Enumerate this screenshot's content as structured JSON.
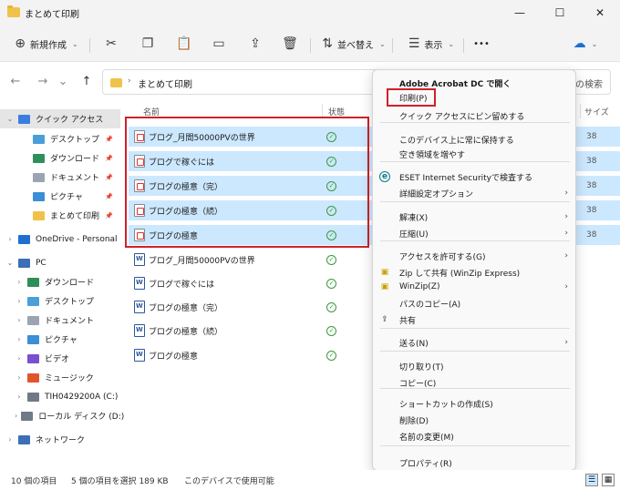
{
  "window": {
    "title": "まとめて印刷",
    "minimize": "—",
    "maximize": "☐",
    "close": "✕"
  },
  "toolbar": {
    "new_label": "新規作成",
    "sort_label": "並べ替え",
    "view_label": "表示",
    "more_label": "•••"
  },
  "address": {
    "path": "まとめて印刷",
    "search_placeholder": "の検索"
  },
  "sidebar": {
    "items": [
      {
        "label": "クイック アクセス",
        "color": "#3b7de0"
      },
      {
        "label": "デスクトップ",
        "color": "#4a9fd8",
        "pinned": true
      },
      {
        "label": "ダウンロード",
        "color": "#2f8f5a",
        "pinned": true
      },
      {
        "label": "ドキュメント",
        "color": "#9aa5b1",
        "pinned": true
      },
      {
        "label": "ピクチャ",
        "color": "#3a8fd6",
        "pinned": true
      },
      {
        "label": "まとめて印刷",
        "color": "#f0c24b",
        "pinned": true
      },
      {
        "label": "OneDrive - Personal",
        "color": "#1e6fd0"
      },
      {
        "label": "PC",
        "color": "#3b6fb6"
      },
      {
        "label": "ダウンロード",
        "color": "#2f8f5a"
      },
      {
        "label": "デスクトップ",
        "color": "#4a9fd8"
      },
      {
        "label": "ドキュメント",
        "color": "#9aa5b1"
      },
      {
        "label": "ピクチャ",
        "color": "#3a8fd6"
      },
      {
        "label": "ビデオ",
        "color": "#7a4fd0"
      },
      {
        "label": "ミュージック",
        "color": "#e0552a"
      },
      {
        "label": "TIH0429200A (C:)",
        "color": "#6f7a86"
      },
      {
        "label": "ローカル ディスク (D:)",
        "color": "#6f7a86"
      },
      {
        "label": "ネットワーク",
        "color": "#3b6fb6"
      }
    ]
  },
  "columns": {
    "name": "名前",
    "status": "状態",
    "size": "サイズ"
  },
  "files": [
    {
      "name": "ブログ_月間50000PVの世界",
      "type": "pdf",
      "selected": true,
      "size": "38"
    },
    {
      "name": "ブログで稼ぐには",
      "type": "pdf",
      "selected": true,
      "size": "38"
    },
    {
      "name": "ブログの極意（完）",
      "type": "pdf",
      "selected": true,
      "size": "38"
    },
    {
      "name": "ブログの極意（続）",
      "type": "pdf",
      "selected": true,
      "size": "38"
    },
    {
      "name": "ブログの極意",
      "type": "pdf",
      "selected": true,
      "size": "38"
    },
    {
      "name": "ブログ_月間50000PVの世界",
      "type": "doc",
      "selected": false,
      "size": ""
    },
    {
      "name": "ブログで稼ぐには",
      "type": "doc",
      "selected": false,
      "size": ""
    },
    {
      "name": "ブログの極意（完）",
      "type": "doc",
      "selected": false,
      "size": ""
    },
    {
      "name": "ブログの極意（続）",
      "type": "doc",
      "selected": false,
      "size": ""
    },
    {
      "name": "ブログの極意",
      "type": "doc",
      "selected": false,
      "size": ""
    }
  ],
  "context_menu": {
    "items": [
      {
        "label": "Adobe Acrobat DC で開く",
        "bold": true
      },
      {
        "label": "印刷(P)"
      },
      {
        "label": "クイック アクセスにピン留めする"
      },
      {
        "sep": true
      },
      {
        "label": "このデバイス上に常に保持する"
      },
      {
        "label": "空き領域を増やす"
      },
      {
        "sep": true
      },
      {
        "label": "ESET Internet Securityで検査する",
        "icon": "eset-icon"
      },
      {
        "label": "詳細設定オプション",
        "arrow": true
      },
      {
        "sep": true
      },
      {
        "label": "解凍(X)",
        "arrow": true
      },
      {
        "label": "圧縮(U)",
        "arrow": true
      },
      {
        "sep": true
      },
      {
        "label": "アクセスを許可する(G)",
        "arrow": true
      },
      {
        "label": "Zip して共有 (WinZip Express)",
        "icon": "winzip-icon"
      },
      {
        "label": "WinZip(Z)",
        "icon": "winzip-icon",
        "arrow": true
      },
      {
        "label": "パスのコピー(A)"
      },
      {
        "label": "共有",
        "icon": "share-icon"
      },
      {
        "sep": true
      },
      {
        "label": "送る(N)",
        "arrow": true
      },
      {
        "sep": true
      },
      {
        "label": "切り取り(T)"
      },
      {
        "label": "コピー(C)"
      },
      {
        "sep": true
      },
      {
        "label": "ショートカットの作成(S)"
      },
      {
        "label": "削除(D)"
      },
      {
        "label": "名前の変更(M)"
      },
      {
        "sep": true
      },
      {
        "label": "プロパティ(R)"
      }
    ]
  },
  "status": {
    "item_count": "10 個の項目",
    "selected": "5 個の項目を選択 189 KB",
    "availability": "このデバイスで使用可能"
  },
  "colors": {
    "accent": "#0067c0",
    "selection": "#cce8ff",
    "highlight_box": "#d0202a"
  }
}
